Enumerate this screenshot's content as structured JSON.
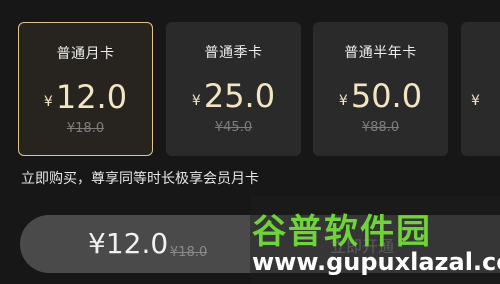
{
  "plans": [
    {
      "name": "普通月卡",
      "currency": "¥",
      "price": "12.0",
      "original": "¥18.0",
      "selected": true
    },
    {
      "name": "普通季卡",
      "currency": "¥",
      "price": "25.0",
      "original": "¥45.0",
      "selected": false
    },
    {
      "name": "普通半年卡",
      "currency": "¥",
      "price": "50.0",
      "original": "¥88.0",
      "selected": false
    },
    {
      "name": "",
      "currency": "¥",
      "price": "",
      "original": "",
      "selected": false
    }
  ],
  "note": "立即购买，尊享同等时长极享会员月卡",
  "paybar": {
    "currency": "¥",
    "price": "12.0",
    "original": "¥18.0",
    "action": "立即开通"
  },
  "watermark": {
    "title": "谷普软件园",
    "url": "www.gupuxlazal.com"
  },
  "colors": {
    "background": "#171717",
    "card": "#2a2a2a",
    "selected_border": "#e2c48a",
    "price_gold": "#f3e4c2",
    "paybar": "#4a4a4a",
    "watermark_green": "#6fd33a"
  }
}
